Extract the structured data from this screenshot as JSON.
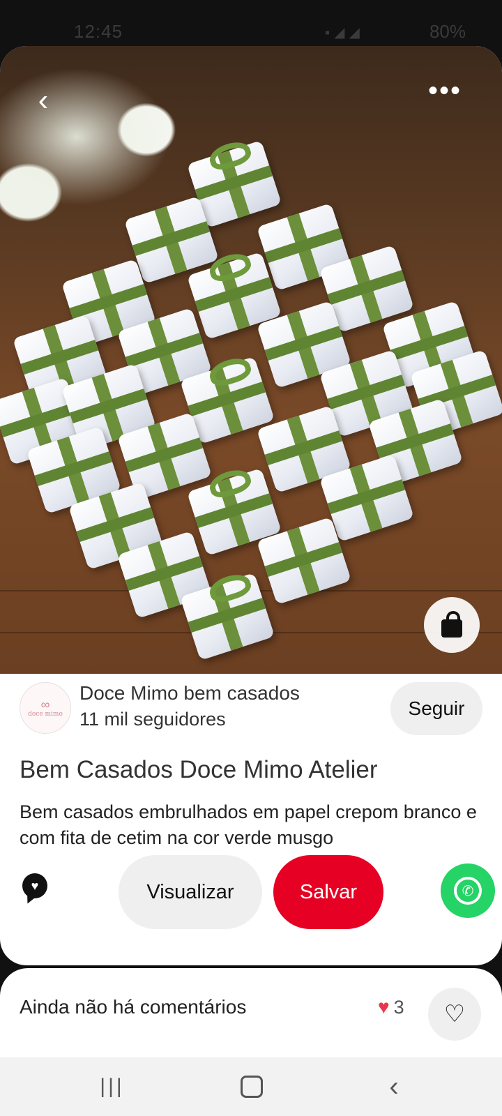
{
  "status_bar": {
    "time": "12:45",
    "battery": "80%"
  },
  "pin": {
    "image_alt": "Bem casados embrulhados em papel crepom branco com fita verde",
    "back_icon": "chevron-left-icon",
    "more_icon": "more-horizontal-icon",
    "shop_icon": "shopping-bag-icon"
  },
  "creator": {
    "avatar_text": "doce mimo",
    "name": "Doce Mimo bem casados",
    "followers": "11 mil seguidores",
    "follow_label": "Seguir"
  },
  "title": "Bem Casados Doce Mimo Atelier",
  "description": "Bem casados embrulhados em papel crepom branco e com fita de cetim na cor verde musgo",
  "actions": {
    "view_label": "Visualizar",
    "save_label": "Salvar",
    "save_color": "#e60023",
    "share_icon": "whatsapp-icon",
    "chat_icon": "comment-heart-icon"
  },
  "comments": {
    "label": "Ainda não há comentários",
    "reaction_count": "3",
    "reaction_icon": "heart-reaction-icon",
    "like_icon": "heart-outline-icon"
  },
  "nav": {
    "recent_icon": "recent-apps-icon",
    "home_icon": "home-icon",
    "back_icon": "back-icon"
  }
}
